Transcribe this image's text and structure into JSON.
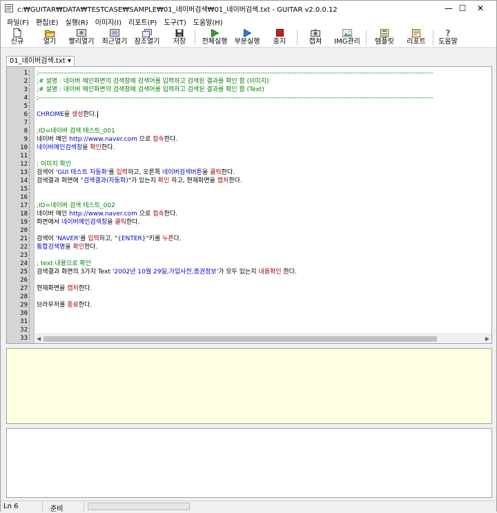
{
  "window": {
    "title": "c:₩GUITAR₩DATA₩TESTCASE₩SAMPLE₩01_네이버검색₩01_네이버검색.txt - GUITAR v2.0.0.12",
    "minimize": "—",
    "maximize": "☐",
    "close": "✕"
  },
  "menu": [
    "파일(F)",
    "편집(E)",
    "실행(R)",
    "이미지(I)",
    "리포트(P)",
    "도구(T)",
    "도움말(H)"
  ],
  "toolbar": [
    {
      "label": "신규",
      "icon": "new-file-icon"
    },
    {
      "label": "열기",
      "icon": "open-folder-icon"
    },
    {
      "label": "빨리열기",
      "icon": "quick-open-icon"
    },
    {
      "label": "최근열기",
      "icon": "recent-open-icon"
    },
    {
      "label": "참조열기",
      "icon": "reference-open-icon"
    },
    {
      "label": "저장",
      "icon": "save-disk-icon"
    },
    {
      "label": "전체실행",
      "icon": "run-all-icon"
    },
    {
      "label": "부분실행",
      "icon": "run-partial-icon"
    },
    {
      "label": "중지",
      "icon": "stop-icon"
    },
    {
      "label": "캡쳐",
      "icon": "camera-icon"
    },
    {
      "label": "IMG관리",
      "icon": "image-manage-icon"
    },
    {
      "label": "템플릿",
      "icon": "template-icon"
    },
    {
      "label": "리포트",
      "icon": "report-icon"
    },
    {
      "label": "도움말",
      "icon": "help-icon"
    }
  ],
  "tab": {
    "label": "01_네이버검색.txt ▾"
  },
  "editor": {
    "line_numbers": [
      "1",
      "2",
      "3",
      "4",
      "5",
      "6",
      "7",
      "8",
      "9",
      "10",
      "11",
      "12",
      "13",
      "14",
      "15",
      "16",
      "17",
      "18",
      "19",
      "20",
      "21",
      "22",
      "23",
      "24",
      "25",
      "26",
      "27",
      "28",
      "29",
      "30",
      "31",
      "32",
      "33"
    ],
    "lines": [
      [
        {
          "t": ";--------------------------------------------------------------------------------------------------------------------------------------------------------------------------------",
          "c": "green"
        }
      ],
      [
        {
          "t": ";# 설명 : 네이버 메인화면의 검색창에 검색어를 입력하고 검색된 결과를 확인 함 (이미지)",
          "c": "green"
        }
      ],
      [
        {
          "t": ";# 설명 : 네이버 메인화면의 검색창에 검색어를 입력하고 검색된 결과를 확인 함 (Text)",
          "c": "green"
        }
      ],
      [
        {
          "t": ";--------------------------------------------------------------------------------------------------------------------------------------------------------------------------------",
          "c": "green"
        }
      ],
      [],
      [
        {
          "t": "CHROME",
          "c": "blue"
        },
        {
          "t": "을 ",
          "c": "black"
        },
        {
          "t": "생성",
          "c": "red"
        },
        {
          "t": "한다.",
          "c": "black"
        }
      ],
      [],
      [
        {
          "t": ";ID=네이버 검색 테스트_001",
          "c": "green"
        }
      ],
      [
        {
          "t": "네이버 메인 ",
          "c": "black"
        },
        {
          "t": "http://www.naver.com",
          "c": "blue"
        },
        {
          "t": " 으로 ",
          "c": "black"
        },
        {
          "t": "접속",
          "c": "red"
        },
        {
          "t": "한다.",
          "c": "black"
        }
      ],
      [
        {
          "t": "네이버메인검색창",
          "c": "blue"
        },
        {
          "t": "을 ",
          "c": "black"
        },
        {
          "t": "확인",
          "c": "red"
        },
        {
          "t": "한다.",
          "c": "black"
        }
      ],
      [],
      [
        {
          "t": "; 이미지 확인",
          "c": "green"
        }
      ],
      [
        {
          "t": "검색어 '",
          "c": "black"
        },
        {
          "t": "GUI 테스트 자동화",
          "c": "blue"
        },
        {
          "t": "'를 ",
          "c": "black"
        },
        {
          "t": "입력",
          "c": "red"
        },
        {
          "t": "하고, 오른쪽 ",
          "c": "black"
        },
        {
          "t": "네이버검색버튼",
          "c": "blue"
        },
        {
          "t": "을 ",
          "c": "black"
        },
        {
          "t": "클릭",
          "c": "red"
        },
        {
          "t": "한다.",
          "c": "black"
        }
      ],
      [
        {
          "t": "검색결과 화면에 \"",
          "c": "black"
        },
        {
          "t": "검색결과(자동화)",
          "c": "blue"
        },
        {
          "t": "\"가  있는지 ",
          "c": "black"
        },
        {
          "t": "확인",
          "c": "red"
        },
        {
          "t": " 하고, 현재화면을 ",
          "c": "black"
        },
        {
          "t": "캡처",
          "c": "red"
        },
        {
          "t": "한다.",
          "c": "black"
        }
      ],
      [],
      [],
      [
        {
          "t": ";ID=네이버 검색 테스트_002",
          "c": "green"
        }
      ],
      [
        {
          "t": "네이버 메인 ",
          "c": "black"
        },
        {
          "t": "http://www.naver.com",
          "c": "blue"
        },
        {
          "t": " 으로 ",
          "c": "black"
        },
        {
          "t": "접속",
          "c": "red"
        },
        {
          "t": "한다.",
          "c": "black"
        }
      ],
      [
        {
          "t": "화면에서 ",
          "c": "black"
        },
        {
          "t": "네이버메인검색창",
          "c": "blue"
        },
        {
          "t": "을 ",
          "c": "black"
        },
        {
          "t": "클릭",
          "c": "red"
        },
        {
          "t": "한다.",
          "c": "black"
        }
      ],
      [],
      [
        {
          "t": "검색어 '",
          "c": "black"
        },
        {
          "t": "NAVER",
          "c": "blue"
        },
        {
          "t": "'를 ",
          "c": "black"
        },
        {
          "t": "입력",
          "c": "red"
        },
        {
          "t": "하고, \"",
          "c": "black"
        },
        {
          "t": "{ENTER}",
          "c": "blue"
        },
        {
          "t": "\"키를 ",
          "c": "black"
        },
        {
          "t": "누른",
          "c": "red"
        },
        {
          "t": "다.",
          "c": "black"
        }
      ],
      [
        {
          "t": "통합검색명",
          "c": "blue"
        },
        {
          "t": "을 ",
          "c": "black"
        },
        {
          "t": "확인",
          "c": "red"
        },
        {
          "t": "한다.",
          "c": "black"
        }
      ],
      [],
      [
        {
          "t": "; text 내용으로 확인",
          "c": "green"
        }
      ],
      [
        {
          "t": "검색결과 화면의 3가지 Text '",
          "c": "black"
        },
        {
          "t": "2002년 10월 29일,가입사전,증권정보",
          "c": "blue"
        },
        {
          "t": "'가 모두 있는지 ",
          "c": "black"
        },
        {
          "t": "내용확인",
          "c": "red"
        },
        {
          "t": " 한다.",
          "c": "black"
        }
      ],
      [],
      [
        {
          "t": "현재화면을 ",
          "c": "black"
        },
        {
          "t": "캡처",
          "c": "red"
        },
        {
          "t": "한다.",
          "c": "black"
        }
      ],
      [],
      [
        {
          "t": "브라우저를 ",
          "c": "black"
        },
        {
          "t": "종료",
          "c": "red"
        },
        {
          "t": "한다.",
          "c": "black"
        }
      ],
      [],
      [],
      [],
      []
    ]
  },
  "status": {
    "line": "Ln 6",
    "state": "준비",
    "progress": 0
  },
  "colors": {
    "green": "#008000",
    "blue": "#0000c8",
    "red": "#a00000",
    "output_bg": "#ffffe1"
  }
}
